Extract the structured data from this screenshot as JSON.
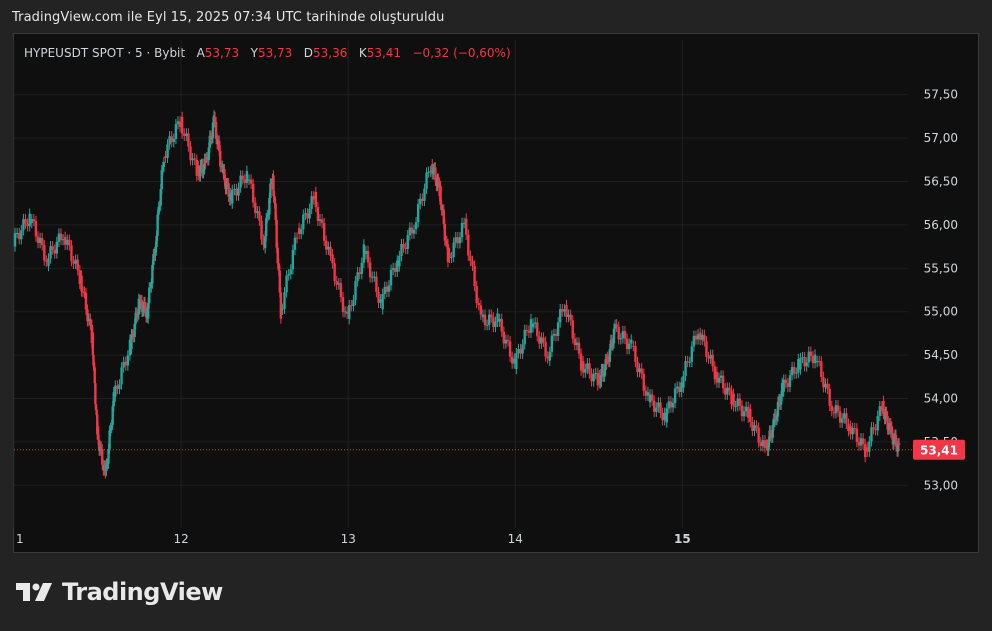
{
  "caption": "TradingView.com ile Eyl 15, 2025 07:34 UTC tarihinde oluşturuldu",
  "header": {
    "symbol": "HYPEUSDT SPOT · 5 · Bybit",
    "open_label": "A",
    "open": "53,73",
    "high_label": "Y",
    "high": "53,73",
    "low_label": "D",
    "low": "53,36",
    "close_label": "K",
    "close": "53,41",
    "change": "−0,32 (−0,60%)"
  },
  "price_badge": "53,41",
  "logo_text": "TradingView",
  "colors": {
    "up": "#26a69a",
    "down": "#f23645",
    "background": "#0f0f0f",
    "grid": "#1f1f1f"
  },
  "chart_data": {
    "type": "candlestick-line",
    "title": "HYPEUSDT SPOT · 5 · Bybit",
    "x_tick_labels": [
      "1",
      "12",
      "13",
      "14",
      "15"
    ],
    "y_tick_labels": [
      "57,50",
      "57,00",
      "56,50",
      "56,00",
      "55,50",
      "55,00",
      "54,50",
      "54,00",
      "53,50",
      "53,00"
    ],
    "ylim": [
      52.6,
      57.9
    ],
    "last_price": 53.41,
    "grid": true,
    "x": [
      0,
      0.1,
      0.2,
      0.3,
      0.4,
      0.47,
      0.5,
      0.55,
      0.6,
      0.7,
      0.75,
      0.8,
      0.85,
      0.9,
      1.0,
      1.1,
      1.15,
      1.2,
      1.25,
      1.3,
      1.4,
      1.5,
      1.55,
      1.6,
      1.7,
      1.8,
      1.9,
      2.0,
      2.1,
      2.2,
      2.3,
      2.4,
      2.5,
      2.55,
      2.6,
      2.7,
      2.8,
      2.9,
      3.0,
      3.1,
      3.2,
      3.3,
      3.4,
      3.5,
      3.55,
      3.6,
      3.7,
      3.8,
      3.9,
      4.0,
      4.1,
      4.2,
      4.3,
      4.4,
      4.5,
      4.55,
      4.6,
      4.7,
      4.8,
      4.9,
      5.0,
      5.1,
      5.2,
      5.25,
      5.3
    ],
    "y": [
      55.8,
      56.1,
      55.6,
      55.9,
      55.4,
      54.7,
      53.6,
      53.1,
      54.0,
      54.6,
      55.1,
      55.0,
      55.8,
      56.8,
      57.2,
      56.6,
      56.7,
      57.2,
      56.6,
      56.3,
      56.6,
      55.8,
      56.6,
      55.0,
      55.9,
      56.3,
      55.6,
      54.9,
      55.7,
      55.1,
      55.6,
      56.0,
      56.7,
      56.4,
      55.6,
      56.0,
      54.9,
      54.9,
      54.4,
      54.9,
      54.5,
      55.1,
      54.4,
      54.2,
      54.4,
      54.8,
      54.6,
      54.0,
      53.8,
      54.2,
      54.8,
      54.3,
      54.0,
      53.8,
      53.4,
      53.7,
      54.1,
      54.4,
      54.5,
      53.9,
      53.7,
      53.4,
      53.9,
      53.6,
      53.41
    ]
  }
}
